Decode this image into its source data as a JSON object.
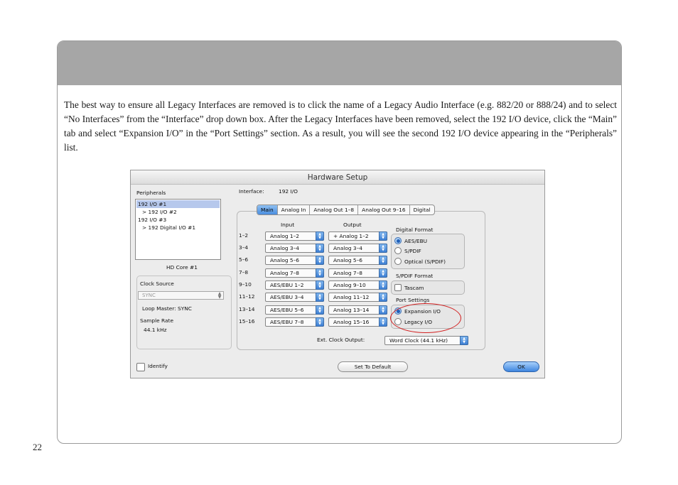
{
  "page": {
    "paragraph": "The best way to ensure all Legacy Interfaces are removed is to click the name of a Legacy Audio Interface (e.g. 882/20 or 888/24) and to select “No Interfaces” from the “Interface” drop down box. After the Legacy Interfaces have been removed, select the 192 I/O device, click the “Main” tab and select “Expansion I/O” in the “Port Settings” section. As a result, you will see the second 192 I/O device appearing in the “Peripherals” list.",
    "page_number": "22"
  },
  "dialog": {
    "title": "Hardware Setup",
    "peripherals_label": "Peripherals",
    "peripherals": [
      "192 I/O #1",
      "> 192 I/O #2",
      "192 I/O #3",
      "> 192 Digital I/O #1"
    ],
    "hd_core": "HD Core #1",
    "interface_label": "Interface:",
    "interface_value": "192 I/O",
    "clock_source_label": "Clock Source",
    "clock_source_value": "SYNC",
    "loop_master": "Loop Master: SYNC",
    "sample_rate_label": "Sample Rate",
    "sample_rate_value": "44.1 kHz",
    "tabs": [
      "Main",
      "Analog In",
      "Analog Out 1–8",
      "Analog Out 9–16",
      "Digital"
    ],
    "input_header": "Input",
    "output_header": "Output",
    "channels": [
      "1–2",
      "3–4",
      "5–6",
      "7–8",
      "9–10",
      "11–12",
      "13–14",
      "15–16"
    ],
    "inputs": [
      "Analog 1–2",
      "Analog 3–4",
      "Analog 5–6",
      "Analog 7–8",
      "AES/EBU 1–2",
      "AES/EBU 3–4",
      "AES/EBU 5–6",
      "AES/EBU 7–8"
    ],
    "outputs": [
      "+ Analog 1–2",
      "Analog 3–4",
      "Analog 5–6",
      "Analog 7–8",
      "Analog 9–10",
      "Analog 11–12",
      "Analog 13–14",
      "Analog 15–16"
    ],
    "digital_format_label": "Digital Format",
    "digital_format_options": [
      "AES/EBU",
      "S/PDIF",
      "Optical (S/PDIF)"
    ],
    "spdif_format_label": "S/PDIF Format",
    "tascam_label": "Tascam",
    "port_settings_label": "Port Settings",
    "port_settings_options": [
      "Expansion I/O",
      "Legacy I/O"
    ],
    "ext_clock_label": "Ext. Clock Output:",
    "ext_clock_value": "Word Clock (44.1 kHz)",
    "identify_label": "Identify",
    "set_default_label": "Set To Default",
    "ok_label": "OK"
  }
}
